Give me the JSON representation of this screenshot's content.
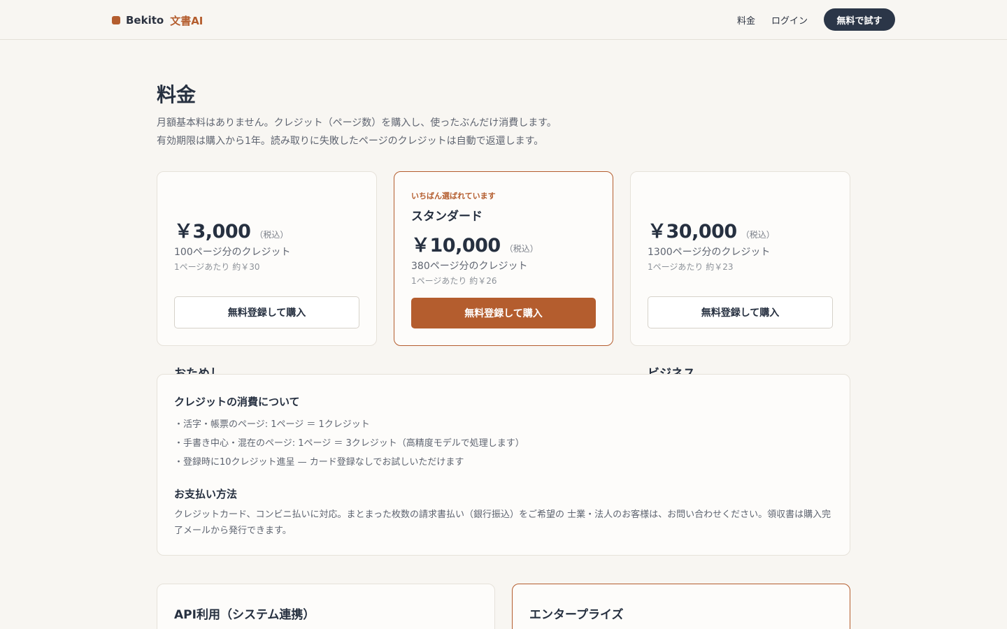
{
  "header": {
    "brand_name": "Bekito",
    "brand_sub": "文書AI",
    "nav_pricing": "料金",
    "nav_login": "ログイン",
    "cta": "無料で試す"
  },
  "page": {
    "title": "料金",
    "lead_line1": "月額基本料はありません。クレジット（ページ数）を購入し、使ったぶんだけ消費します。",
    "lead_line2": "有効期限は購入から1年。読み取りに失敗したページのクレジットは自動で返還します。"
  },
  "plans": [
    {
      "name": "おためし",
      "price": "￥3,000",
      "tax": "（税込）",
      "credits": "100ページ分のクレジット",
      "per_page": "1ページあたり 約￥30",
      "button": "無料登録して購入"
    },
    {
      "tag": "いちばん選ばれています",
      "name": "スタンダード",
      "price": "￥10,000",
      "tax": "（税込）",
      "credits": "380ページ分のクレジット",
      "per_page": "1ページあたり 約￥26",
      "button": "無料登録して購入"
    },
    {
      "name": "ビジネス",
      "price": "￥30,000",
      "tax": "（税込）",
      "credits": "1300ページ分のクレジット",
      "per_page": "1ページあたり 約￥23",
      "button": "無料登録して購入"
    }
  ],
  "info": {
    "credit_title": "クレジットの消費について",
    "credit_items": [
      "・活字・帳票のページ: 1ページ ＝ 1クレジット",
      "・手書き中心・混在のページ: 1ページ ＝ 3クレジット（高精度モデルで処理します）",
      "・登録時に10クレジット進呈 — カード登録なしでお試しいただけます"
    ],
    "payment_title": "お支払い方法",
    "payment_text": "クレジットカード、コンビニ払いに対応。まとまった枚数の請求書払い（銀行振込）をご希望の 士業・法人のお客様は、お問い合わせください。領収書は購入完了メールから発行できます。"
  },
  "bottom_cards": {
    "api_title": "API利用（システム連携）",
    "enterprise_title": "エンタープライズ"
  },
  "colors": {
    "accent": "#b45d2e",
    "dark": "#2b3648",
    "background": "#f8f6f2"
  }
}
